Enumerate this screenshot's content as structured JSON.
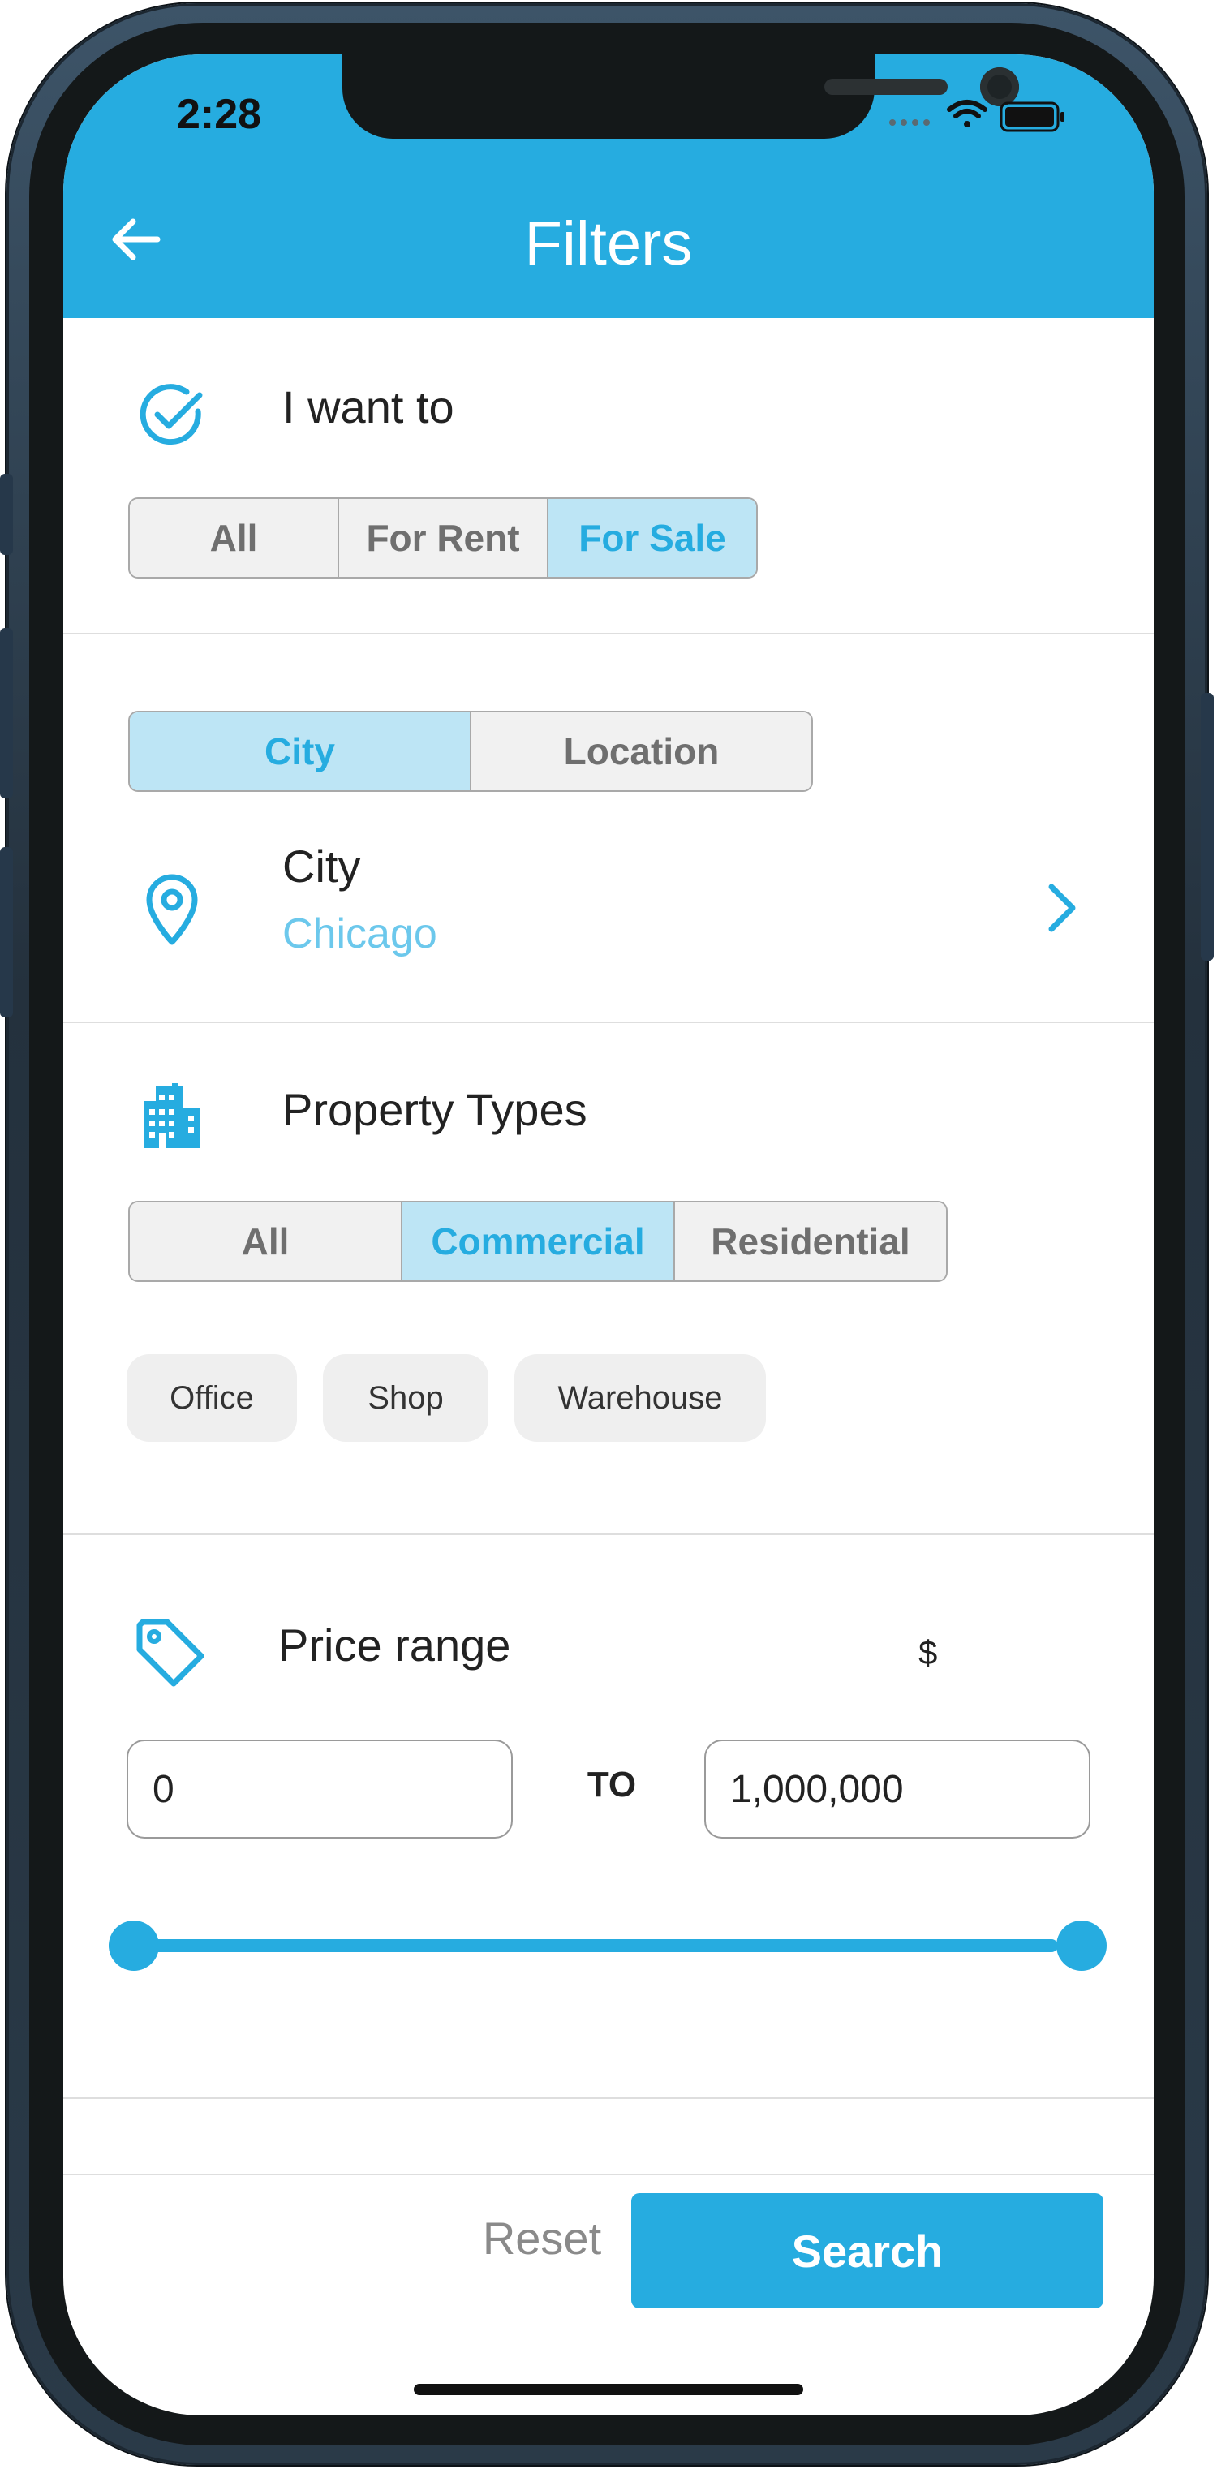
{
  "status_bar": {
    "time": "2:28"
  },
  "header": {
    "title": "Filters"
  },
  "want_to": {
    "title": "I want to",
    "options": [
      "All",
      "For Rent",
      "For Sale"
    ],
    "selected": "For Sale"
  },
  "location": {
    "mode_options": [
      "City",
      "Location"
    ],
    "selected_mode": "City",
    "field_label": "City",
    "field_value": "Chicago"
  },
  "property_types": {
    "title": "Property Types",
    "options": [
      "All",
      "Commercial",
      "Residential"
    ],
    "selected": "Commercial",
    "subtypes": [
      "Office",
      "Shop",
      "Warehouse"
    ]
  },
  "price_range": {
    "title": "Price range",
    "currency": "$",
    "min": "0",
    "to_label": "TO",
    "max": "1,000,000",
    "slider_low_fraction": 0,
    "slider_high_fraction": 1
  },
  "footer": {
    "reset_label": "Reset",
    "search_label": "Search"
  },
  "colors": {
    "accent": "#26ace0",
    "accent_light": "#bde5f5",
    "frame": "#24313d"
  },
  "icons": [
    "back-arrow-icon",
    "check-circle-icon",
    "map-pin-icon",
    "chevron-right-icon",
    "building-icon",
    "price-tag-icon",
    "wifi-icon",
    "battery-icon",
    "signal-icon"
  ]
}
